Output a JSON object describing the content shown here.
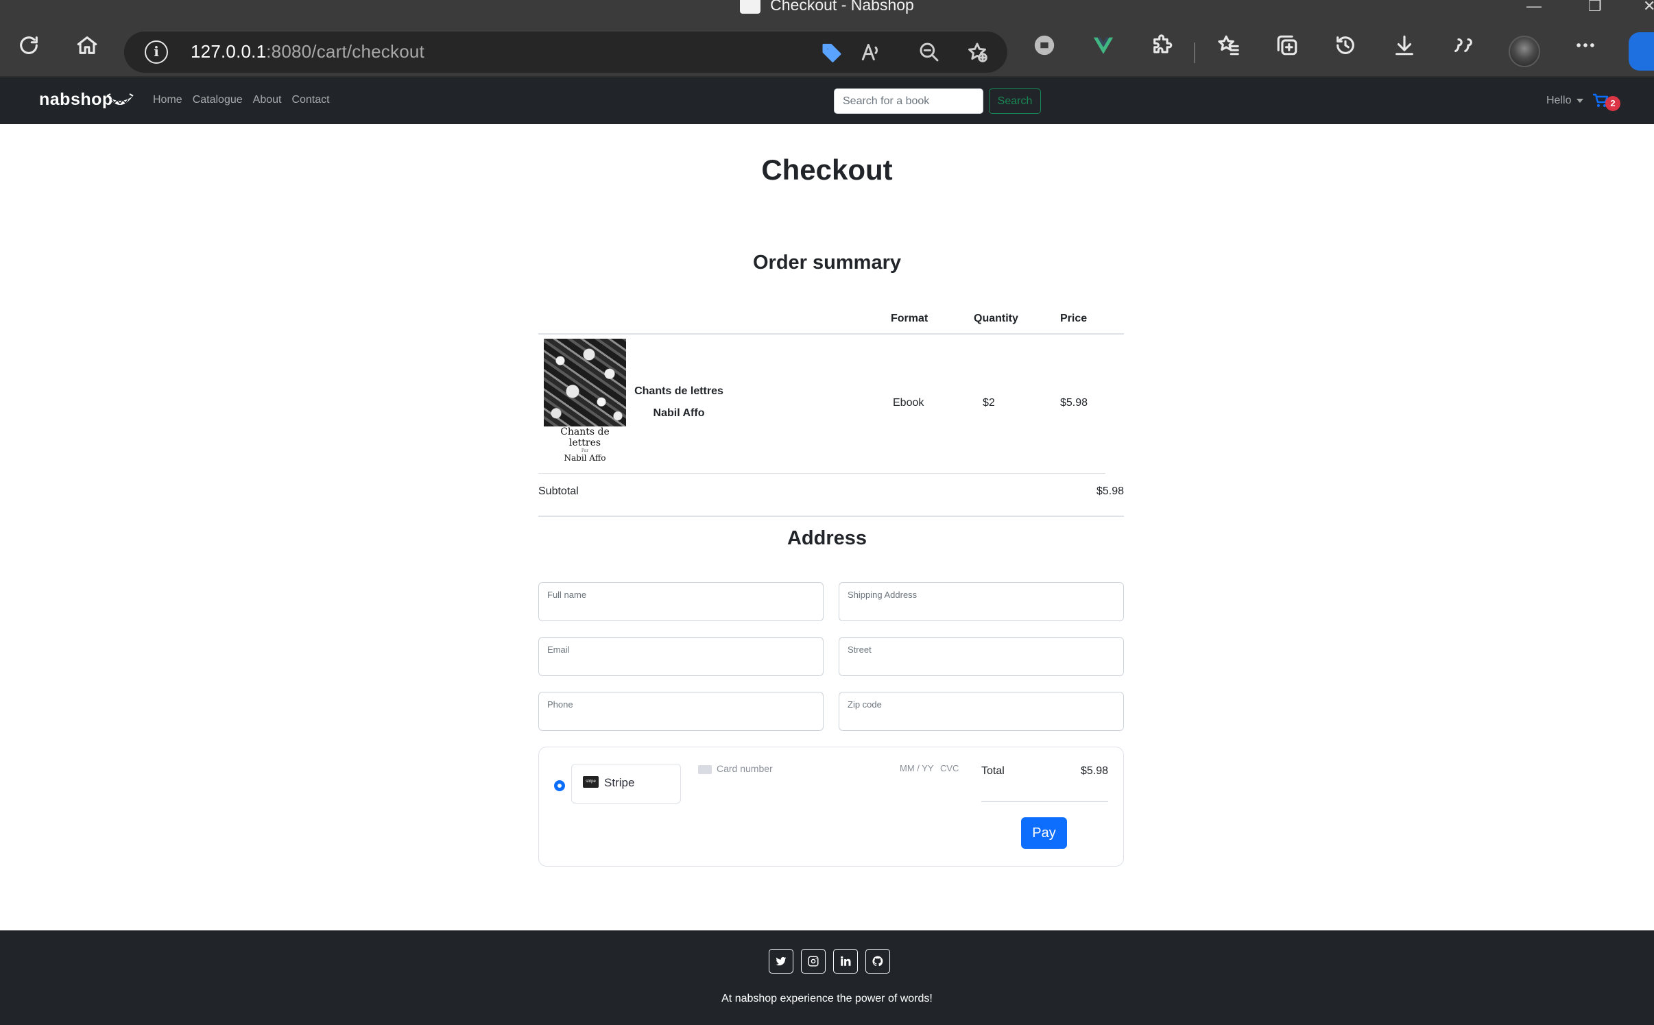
{
  "browser": {
    "window_title": "Checkout - Nabshop",
    "url_host": "127.0.0.1",
    "url_rest": ":8080/cart/checkout",
    "icons": [
      "refresh-icon",
      "home-icon",
      "info-icon",
      "tag-icon",
      "read-aloud-icon",
      "zoom-out-icon",
      "add-favorite-icon",
      "extension-icon",
      "vue-icon",
      "extensions-icon",
      "favorites-icon",
      "collections-icon",
      "history-icon",
      "download-icon",
      "quote-icon",
      "profile-avatar",
      "more-icon",
      "bing-icon"
    ]
  },
  "navbar": {
    "brand": "nabshop",
    "links": [
      "Home",
      "Catalogue",
      "About",
      "Contact"
    ],
    "search_placeholder": "Search for a book",
    "search_button": "Search",
    "user_menu": "Hello",
    "cart_count": "2"
  },
  "page": {
    "title": "Checkout",
    "order_summary_title": "Order summary",
    "address_title": "Address"
  },
  "order": {
    "columns": {
      "format": "Format",
      "quantity": "Quantity",
      "price": "Price"
    },
    "items": [
      {
        "cover_title": "Chants de lettres",
        "cover_by": "Par",
        "cover_author": "Nabil Affo",
        "title": "Chants de lettres",
        "author": "Nabil Affo",
        "format": "Ebook",
        "quantity": "$2",
        "price": "$5.98"
      }
    ],
    "subtotal_label": "Subtotal",
    "subtotal_value": "$5.98"
  },
  "address_form": {
    "full_name": "Full name",
    "shipping_address": "Shipping Address",
    "email": "Email",
    "street": "Street",
    "phone": "Phone",
    "zip_code": "Zip code"
  },
  "payment": {
    "method": "Stripe",
    "method_logo_text": "stripe",
    "card_number_placeholder": "Card number",
    "expiry_placeholder": "MM / YY",
    "cvc_placeholder": "CVC",
    "total_label": "Total",
    "total_value": "$5.98",
    "pay_button": "Pay"
  },
  "footer": {
    "socials": [
      "twitter-icon",
      "instagram-icon",
      "linkedin-icon",
      "github-icon"
    ],
    "tagline": "At nabshop experience the power of words!"
  },
  "colors": {
    "navbar_bg": "#212529",
    "primary": "#0d6efd",
    "success": "#198754",
    "danger": "#dc3545"
  }
}
